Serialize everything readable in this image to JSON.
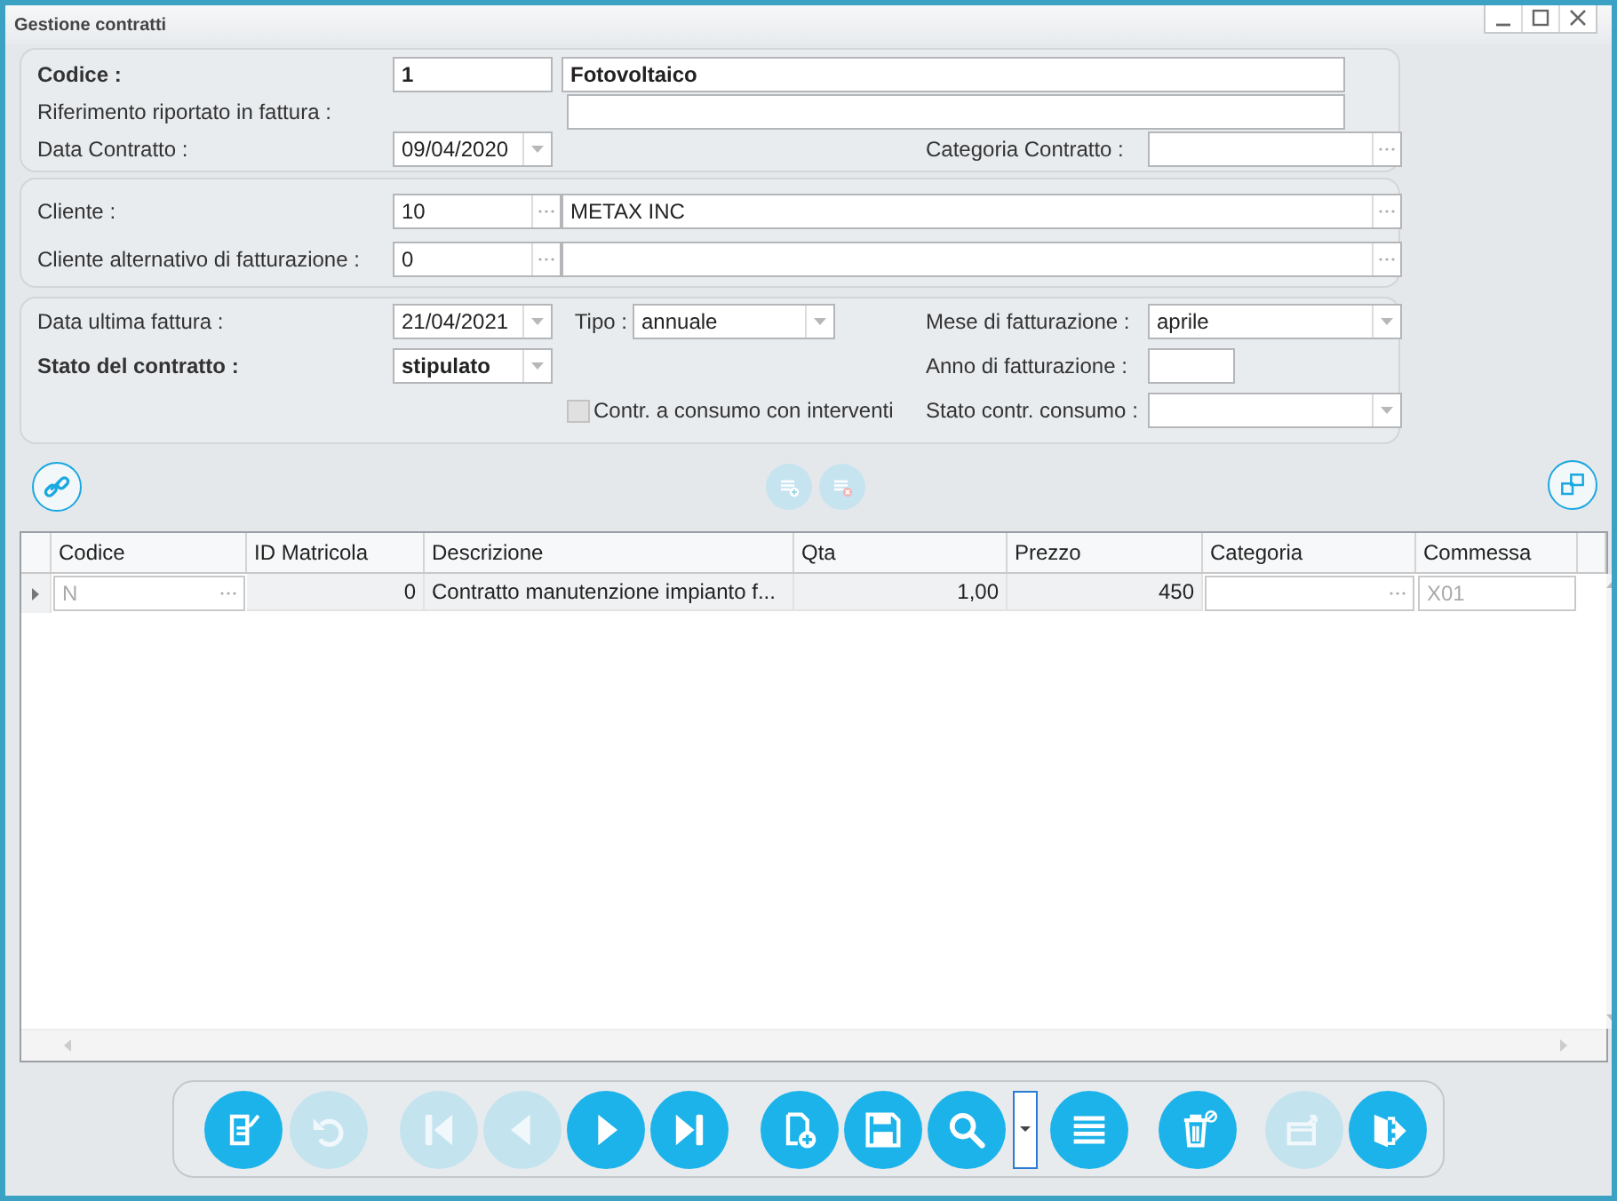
{
  "window": {
    "title": "Gestione contratti"
  },
  "contract": {
    "code": {
      "label": "Codice :",
      "value": "1",
      "name": "Fotovoltaico",
      "emphasis": true
    },
    "reference": {
      "label": "Riferimento riportato in fattura :"
    },
    "date": {
      "label": "Data Contratto  :",
      "value": "09/04/2020"
    },
    "category": {
      "label": "Categoria Contratto  :"
    }
  },
  "customer": {
    "customer": {
      "label": "Cliente :",
      "code": "10",
      "name": "METAX INC"
    },
    "billing_customer": {
      "label": "Cliente alternativo di fatturazione :",
      "code": "0"
    }
  },
  "billing": {
    "last_invoice": {
      "label": "Data ultima fattura  :",
      "value": "21/04/2021"
    },
    "type": {
      "label": "Tipo :",
      "value": "annuale"
    },
    "month": {
      "label": "Mese di fatturazione :",
      "value": "aprile"
    },
    "status": {
      "label": "Stato del contratto :",
      "value": "stipulato",
      "emphasis": true
    },
    "year": {
      "label": "Anno di fatturazione :"
    },
    "consumption": {
      "label": "Contr. a consumo con interventi",
      "checked": false
    },
    "consumption_status": {
      "label": "Stato contr. consumo :"
    }
  },
  "grid_tools": [
    {
      "kind": "link",
      "disabled": false
    },
    {
      "kind": "add-row",
      "disabled": true
    },
    {
      "kind": "remove-row",
      "disabled": true
    },
    {
      "kind": "window",
      "disabled": false
    }
  ],
  "table": {
    "columns": [
      {
        "label": "Codice",
        "kind": "lookup"
      },
      {
        "label": "ID Matricola",
        "kind": "number"
      },
      {
        "label": "Descrizione",
        "kind": "text"
      },
      {
        "label": "Qta",
        "kind": "number"
      },
      {
        "label": "Prezzo",
        "kind": "number"
      },
      {
        "label": "Categoria",
        "kind": "lookup"
      },
      {
        "label": "Commessa",
        "kind": "input"
      }
    ],
    "rows": [
      {
        "selected": true,
        "cells": [
          "N",
          "0",
          "Contratto manutenzione impianto f...",
          "1,00",
          "450",
          null,
          "X01"
        ]
      }
    ]
  },
  "toolbar": [
    {
      "kind": "edit",
      "disabled": false
    },
    {
      "kind": "undo",
      "disabled": true
    },
    {
      "kind": "first",
      "disabled": true
    },
    {
      "kind": "previous",
      "disabled": true
    },
    {
      "kind": "next",
      "disabled": false
    },
    {
      "kind": "last",
      "disabled": false
    },
    {
      "kind": "new",
      "disabled": false
    },
    {
      "kind": "save",
      "disabled": false
    },
    {
      "kind": "search",
      "disabled": false
    },
    {
      "kind": "menu",
      "disabled": false
    },
    {
      "kind": "list",
      "disabled": false
    },
    {
      "kind": "delete",
      "disabled": false
    },
    {
      "kind": "export",
      "disabled": true
    },
    {
      "kind": "exit",
      "disabled": false
    }
  ]
}
